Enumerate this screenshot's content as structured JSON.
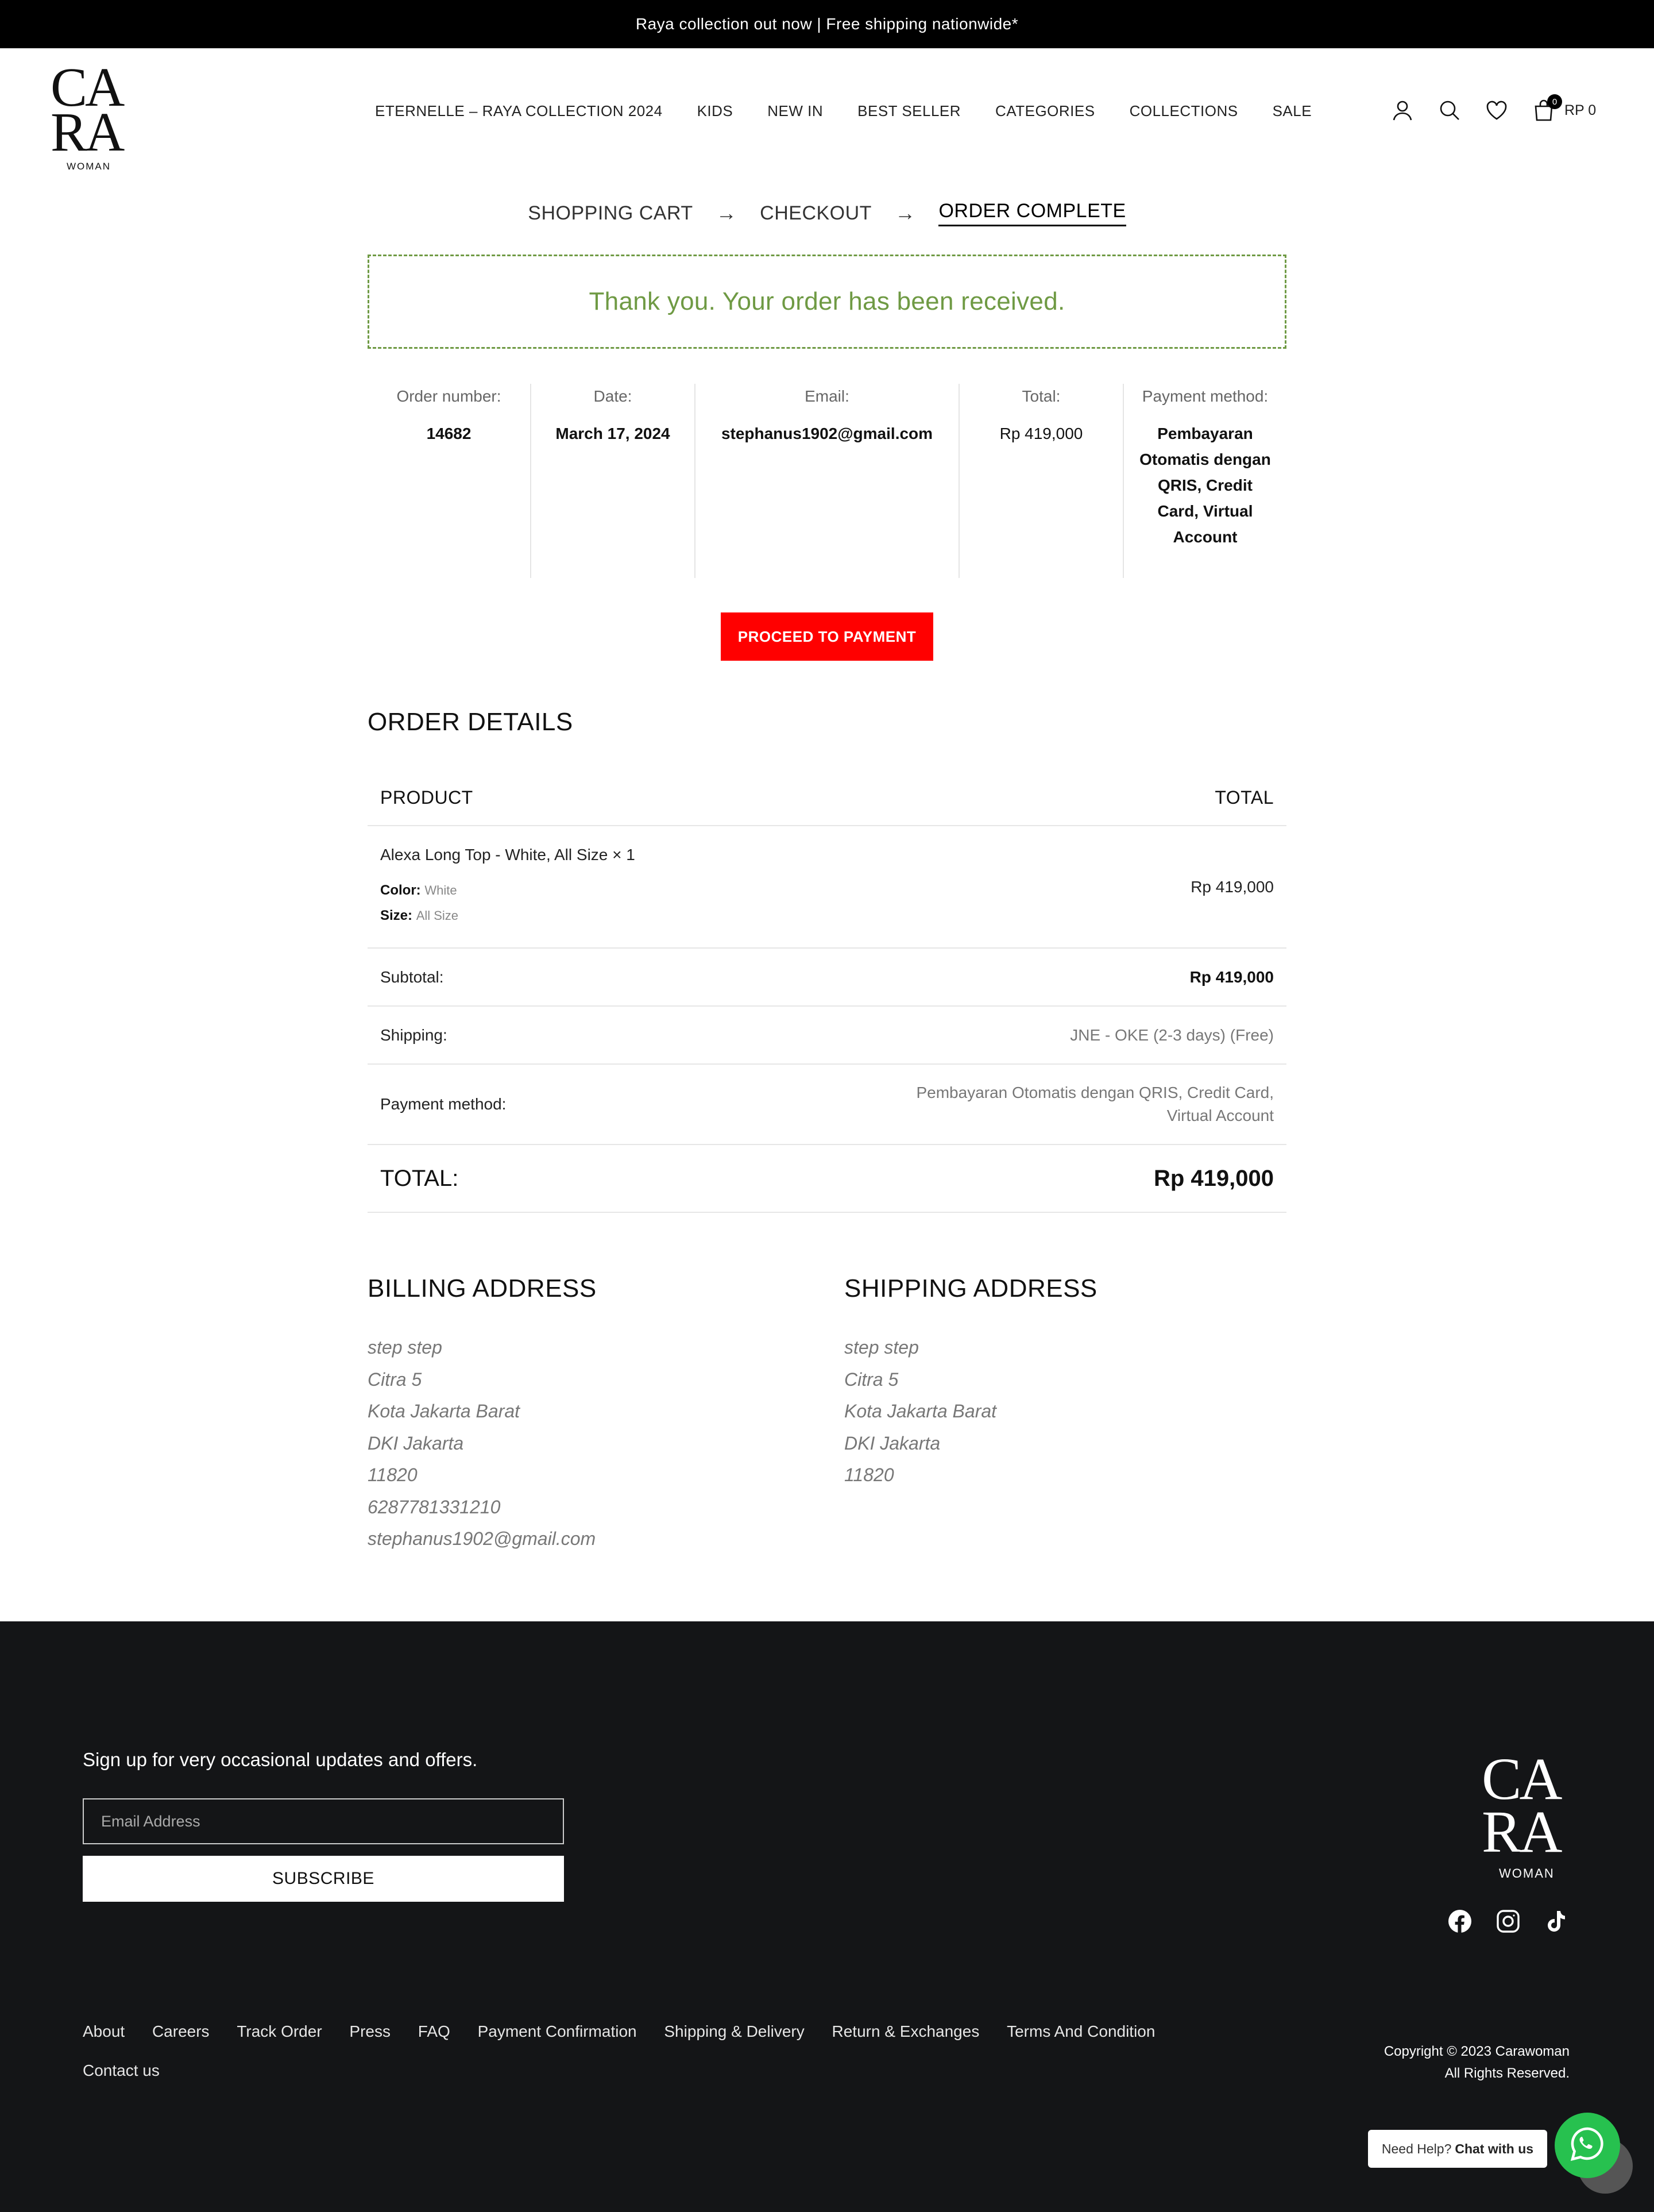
{
  "announcement": "Raya collection out now | Free shipping nationwide*",
  "logo": {
    "line1": "CA",
    "line2": "RA",
    "tag": "WOMAN"
  },
  "nav": [
    "ETERNELLE – RAYA COLLECTION 2024",
    "KIDS",
    "NEW IN",
    "BEST SELLER",
    "CATEGORIES",
    "COLLECTIONS",
    "SALE"
  ],
  "header_icons": {
    "account": "user-icon",
    "search": "search-icon",
    "wishlist": "heart-icon",
    "cart": "bag-icon"
  },
  "cart": {
    "count": "0",
    "total": "RP 0"
  },
  "steps": {
    "cart": "SHOPPING CART",
    "checkout": "CHECKOUT",
    "complete": "ORDER COMPLETE",
    "arrow": "→"
  },
  "thankyou": "Thank you. Your order has been received.",
  "overview": {
    "order_number_label": "Order number:",
    "order_number": "14682",
    "date_label": "Date:",
    "date": "March 17, 2024",
    "email_label": "Email:",
    "email": "stephanus1902@gmail.com",
    "total_label": "Total:",
    "total": "Rp 419,000",
    "payment_label": "Payment method:",
    "payment": "Pembayaran Otomatis dengan QRIS, Credit Card, Virtual Account"
  },
  "proceed_button": "PROCEED TO PAYMENT",
  "order_details": {
    "title": "ORDER DETAILS",
    "col_product": "PRODUCT",
    "col_total": "TOTAL",
    "item": {
      "name": "Alexa Long Top - White, All Size",
      "qty": "× 1",
      "color_label": "Color:",
      "color": "White",
      "size_label": "Size:",
      "size": "All Size",
      "price": "Rp 419,000"
    },
    "subtotal_label": "Subtotal:",
    "subtotal": "Rp 419,000",
    "shipping_label": "Shipping:",
    "shipping": "JNE - OKE (2-3 days) (Free)",
    "payment_label": "Payment method:",
    "payment_line1": "Pembayaran Otomatis dengan QRIS, Credit Card,",
    "payment_line2": "Virtual Account",
    "total_label": "TOTAL:",
    "total": "Rp 419,000"
  },
  "billing": {
    "title": "BILLING ADDRESS",
    "lines": [
      "step step",
      "Citra 5",
      "Kota Jakarta Barat",
      "DKI Jakarta",
      "11820",
      "6287781331210",
      "stephanus1902@gmail.com"
    ]
  },
  "shipping_address": {
    "title": "SHIPPING ADDRESS",
    "lines": [
      "step step",
      "Citra 5",
      "Kota Jakarta Barat",
      "DKI Jakarta",
      "11820"
    ]
  },
  "footer": {
    "signup_text": "Sign up for very occasional updates and offers.",
    "email_placeholder": "Email Address",
    "subscribe": "SUBSCRIBE",
    "socials": [
      "facebook-icon",
      "instagram-icon",
      "tiktok-icon"
    ],
    "links": [
      "About",
      "Careers",
      "Track Order",
      "Press",
      "FAQ",
      "Payment Confirmation",
      "Shipping & Delivery",
      "Return & Exchanges",
      "Terms And Condition",
      "Contact us"
    ],
    "copyright_line1": "Copyright © 2023 Carawoman",
    "copyright_line2": "All Rights Reserved."
  },
  "help": {
    "prefix": "Need Help?",
    "cta": "Chat with us"
  },
  "colors": {
    "accent_green": "#6f9a44",
    "proceed_red": "#ff0000",
    "footer_bg": "#141517",
    "whatsapp": "#27c14f"
  }
}
